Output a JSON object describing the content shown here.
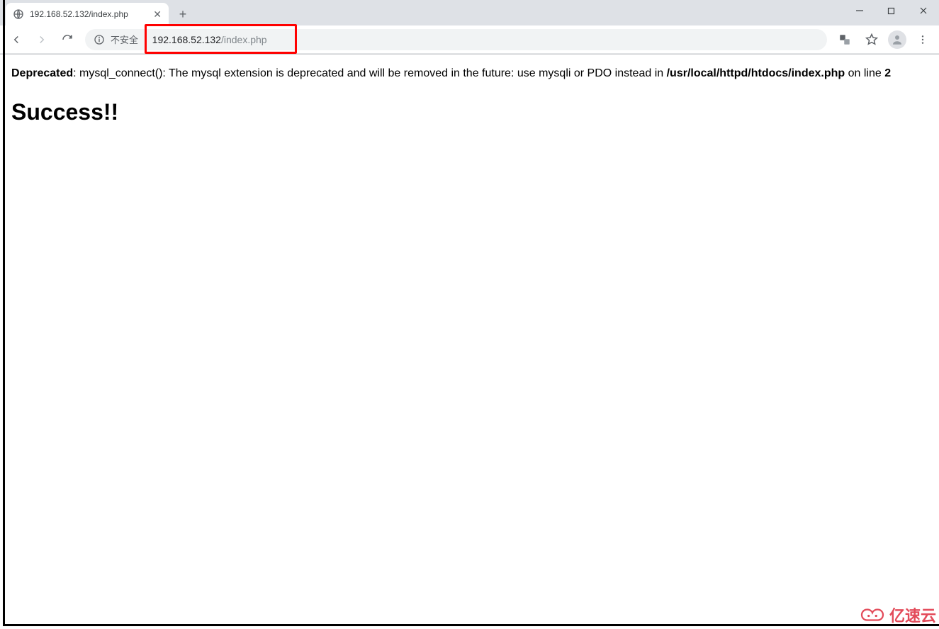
{
  "window": {
    "minimize_tip": "Minimize",
    "maximize_tip": "Maximize",
    "close_tip": "Close"
  },
  "tab": {
    "title": "192.168.52.132/index.php",
    "close_tip": "Close tab",
    "new_tab_tip": "New tab"
  },
  "toolbar": {
    "back_tip": "Back",
    "forward_tip": "Forward",
    "reload_tip": "Reload",
    "security_label": "不安全",
    "url_host": "192.168.52.132",
    "url_path": "/index.php",
    "translate_tip": "Translate",
    "bookmark_tip": "Bookmark",
    "profile_tip": "Profile",
    "menu_tip": "Menu"
  },
  "content": {
    "deprecated_label": "Deprecated",
    "colon_space": ": ",
    "message_body": "mysql_connect(): The mysql extension is deprecated and will be removed in the future: use mysqli or PDO instead in ",
    "file_path": "/usr/local/httpd/htdocs/index.php",
    "on_line_text": " on line ",
    "line_number": "2",
    "success_heading": "Success!!"
  },
  "watermark": {
    "text": "亿速云"
  }
}
